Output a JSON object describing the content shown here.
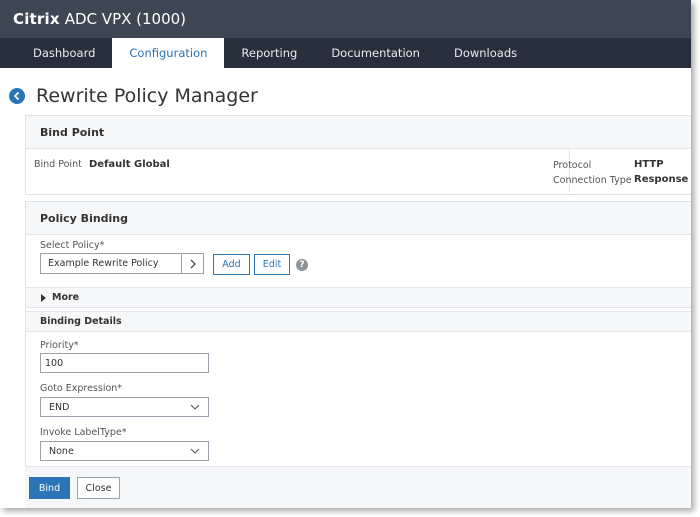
{
  "app": {
    "brand": "Citrix",
    "product": "ADC VPX (1000)"
  },
  "nav": {
    "tabs": [
      "Dashboard",
      "Configuration",
      "Reporting",
      "Documentation",
      "Downloads"
    ],
    "active": 1
  },
  "page": {
    "title": "Rewrite Policy Manager"
  },
  "bind_point": {
    "heading": "Bind Point",
    "label": "Bind Point",
    "value": "Default Global",
    "protocol_label": "Protocol",
    "protocol_value": "HTTP",
    "connection_type_label": "Connection Type",
    "connection_type_value": "Response"
  },
  "policy_binding": {
    "heading": "Policy Binding",
    "select_policy_label": "Select Policy*",
    "select_policy_value": "Example Rewrite Policy",
    "add_label": "Add",
    "edit_label": "Edit",
    "help_icon": "?",
    "more_label": "More",
    "binding_details_heading": "Binding Details",
    "priority_label": "Priority*",
    "priority_value": "100",
    "goto_label": "Goto Expression*",
    "goto_value": "END",
    "invoke_label": "Invoke LabelType*",
    "invoke_value": "None"
  },
  "footer": {
    "bind_label": "Bind",
    "close_label": "Close"
  },
  "colors": {
    "accent": "#2a75b7",
    "topbar": "#3d4754",
    "nav": "#262f3b"
  }
}
